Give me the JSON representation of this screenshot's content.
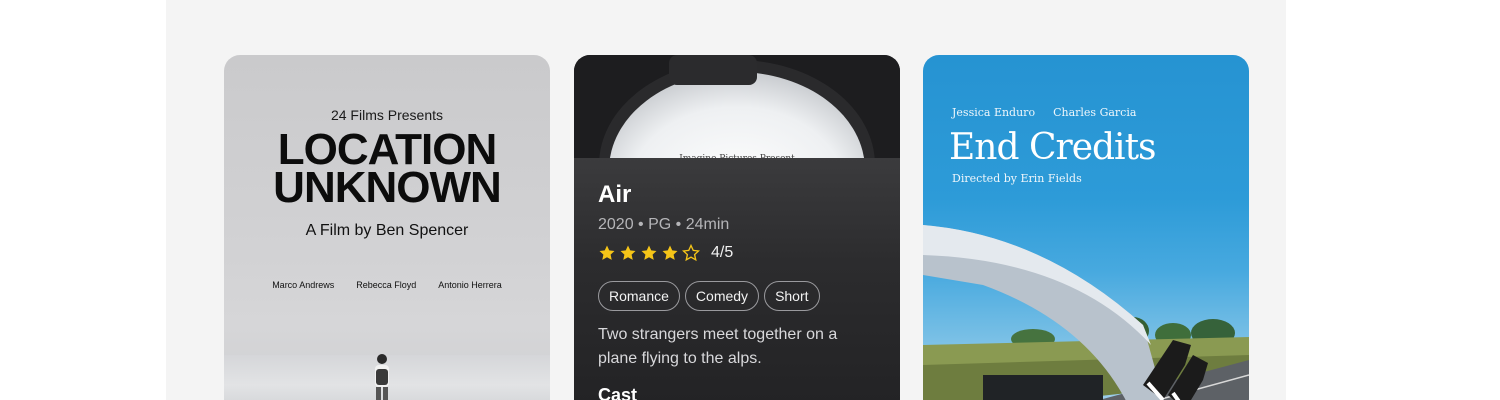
{
  "cards": [
    {
      "presents": "24 Films Presents",
      "title_line1": "LOCATION",
      "title_line2": "UNKNOWN",
      "byline": "A Film by Ben Spencer",
      "cast": [
        "Marco Andrews",
        "Rebecca Floyd",
        "Antonio Herrera"
      ]
    },
    {
      "poster_text": "Imagine Pictures Present",
      "title": "Air",
      "meta": "2020 • PG • 24min",
      "rating": 4,
      "rating_max": 5,
      "rating_text": "4/5",
      "tags": [
        "Romance",
        "Comedy",
        "Short"
      ],
      "description": "Two strangers meet together on a plane flying to the alps.",
      "cast_heading": "Cast"
    },
    {
      "cast": [
        "Jessica Enduro",
        "Charles Garcia"
      ],
      "title": "End Credits",
      "director": "Directed by Erin Fields"
    }
  ],
  "colors": {
    "panel_bg": "#f4f4f4",
    "star": "#f5c518",
    "sky": "#2693d2"
  },
  "icons": {
    "star_filled": "star-filled-icon",
    "star_outline": "star-outline-icon"
  }
}
